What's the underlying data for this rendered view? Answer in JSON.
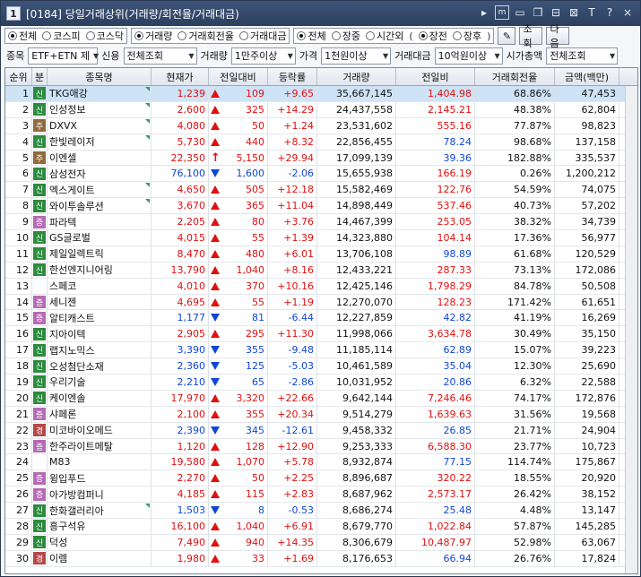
{
  "title": {
    "num": "1",
    "text": "[0184] 당일거래상위(거래량/회전율/거래대금)"
  },
  "toolbar": {
    "icons": [
      "arrow-right-icon",
      "menu-box-icon",
      "window-icon",
      "restore-icon",
      "link-icon",
      "lock-icon",
      "text-T-icon",
      "help-icon",
      "close-icon"
    ],
    "glyph_T": "T",
    "glyph_help": "?",
    "glyph_m": "m",
    "close": "×"
  },
  "market": {
    "options": [
      "전체",
      "코스피",
      "코스닥"
    ],
    "selected": 0
  },
  "sort": {
    "options": [
      "거래량",
      "거래회전율",
      "거래대금"
    ],
    "selected": 0
  },
  "session": {
    "options": [
      "전체",
      "장중",
      "시간외"
    ],
    "selected": 0,
    "sub_options": [
      "장전",
      "장후"
    ],
    "paren_open": "(",
    "paren_close": ")"
  },
  "buttons": {
    "search": "조회",
    "next": "다음"
  },
  "filters": {
    "item_label": "종목",
    "item_value": "ETF+ETN 제",
    "credit_label": "신용",
    "credit_value": "전체조회",
    "volume_label": "거래량",
    "volume_value": "1만주이상",
    "price_label": "가격",
    "price_value": "1천원이상",
    "amount_label": "거래대금",
    "amount_value": "10억원이상",
    "cap_label": "시가총액",
    "cap_value": "전체조회"
  },
  "columns": [
    "순위",
    "분",
    "종목명",
    "현재가",
    "전일대비",
    "등락률",
    "거래량",
    "전일비",
    "거래회전율",
    "금액(백만)"
  ],
  "rows": [
    {
      "rank": "1",
      "tag": "신",
      "tagc": "shin",
      "name": "TKG애강",
      "price": "1,239",
      "dir": "up",
      "chg": "109",
      "rate": "+9.65",
      "vol": "35,667,145",
      "prev": "1,404.98",
      "turn": "68.86%",
      "amt": "47,453",
      "flag": true
    },
    {
      "rank": "2",
      "tag": "신",
      "tagc": "shin",
      "name": "인성정보",
      "price": "2,600",
      "dir": "up",
      "chg": "325",
      "rate": "+14.29",
      "vol": "24,437,558",
      "prev": "2,145.21",
      "turn": "48.38%",
      "amt": "62,804",
      "flag": true
    },
    {
      "rank": "3",
      "tag": "주",
      "tagc": "ju",
      "name": "DXVX",
      "price": "4,080",
      "dir": "up",
      "chg": "50",
      "rate": "+1.24",
      "vol": "23,531,602",
      "prev": "555.16",
      "turn": "77.87%",
      "amt": "98,823",
      "flag": true
    },
    {
      "rank": "4",
      "tag": "신",
      "tagc": "shin",
      "name": "한빛레이저",
      "price": "5,730",
      "dir": "up",
      "chg": "440",
      "rate": "+8.32",
      "vol": "22,856,455",
      "prev": "78.24",
      "turn": "98.68%",
      "amt": "137,158",
      "flag": true
    },
    {
      "rank": "5",
      "tag": "주",
      "tagc": "ju",
      "name": "이엔셀",
      "price": "22,350",
      "dir": "limit",
      "chg": "5,150",
      "rate": "+29.94",
      "vol": "17,099,139",
      "prev": "39.36",
      "turn": "182.88%",
      "amt": "335,537",
      "flag": false
    },
    {
      "rank": "6",
      "tag": "신",
      "tagc": "shin",
      "name": "삼성전자",
      "price": "76,100",
      "dir": "dn",
      "chg": "1,600",
      "rate": "-2.06",
      "vol": "15,655,938",
      "prev": "166.19",
      "turn": "0.26%",
      "amt": "1,200,212",
      "flag": false
    },
    {
      "rank": "7",
      "tag": "신",
      "tagc": "shin",
      "name": "엑스게이트",
      "price": "4,650",
      "dir": "up",
      "chg": "505",
      "rate": "+12.18",
      "vol": "15,582,469",
      "prev": "122.76",
      "turn": "54.59%",
      "amt": "74,075",
      "flag": true
    },
    {
      "rank": "8",
      "tag": "신",
      "tagc": "shin",
      "name": "와이투솔루션",
      "price": "3,670",
      "dir": "up",
      "chg": "365",
      "rate": "+11.04",
      "vol": "14,898,449",
      "prev": "537.46",
      "turn": "40.73%",
      "amt": "57,202",
      "flag": true
    },
    {
      "rank": "9",
      "tag": "증",
      "tagc": "jeung",
      "name": "파라텍",
      "price": "2,205",
      "dir": "up",
      "chg": "80",
      "rate": "+3.76",
      "vol": "14,467,399",
      "prev": "253.05",
      "turn": "38.32%",
      "amt": "34,739",
      "flag": false
    },
    {
      "rank": "10",
      "tag": "신",
      "tagc": "shin",
      "name": "GS글로벌",
      "price": "4,015",
      "dir": "up",
      "chg": "55",
      "rate": "+1.39",
      "vol": "14,323,880",
      "prev": "104.14",
      "turn": "17.36%",
      "amt": "56,977",
      "flag": false
    },
    {
      "rank": "11",
      "tag": "신",
      "tagc": "shin",
      "name": "제일일렉트릭",
      "price": "8,470",
      "dir": "up",
      "chg": "480",
      "rate": "+6.01",
      "vol": "13,706,108",
      "prev": "98.89",
      "turn": "61.68%",
      "amt": "120,529",
      "flag": false
    },
    {
      "rank": "12",
      "tag": "신",
      "tagc": "shin",
      "name": "한선엔지니어링",
      "price": "13,790",
      "dir": "up",
      "chg": "1,040",
      "rate": "+8.16",
      "vol": "12,433,221",
      "prev": "287.33",
      "turn": "73.13%",
      "amt": "172,086",
      "flag": false
    },
    {
      "rank": "13",
      "tag": "",
      "tagc": "",
      "name": "스페코",
      "price": "4,010",
      "dir": "up",
      "chg": "370",
      "rate": "+10.16",
      "vol": "12,425,146",
      "prev": "1,798.29",
      "turn": "84.78%",
      "amt": "50,508",
      "flag": false
    },
    {
      "rank": "14",
      "tag": "증",
      "tagc": "jeung",
      "name": "세니젠",
      "price": "4,695",
      "dir": "up",
      "chg": "55",
      "rate": "+1.19",
      "vol": "12,270,070",
      "prev": "128.23",
      "turn": "171.42%",
      "amt": "61,651",
      "flag": false
    },
    {
      "rank": "15",
      "tag": "증",
      "tagc": "jeung",
      "name": "알티캐스트",
      "price": "1,177",
      "dir": "dn",
      "chg": "81",
      "rate": "-6.44",
      "vol": "12,227,859",
      "prev": "42.82",
      "turn": "41.19%",
      "amt": "16,269",
      "flag": false
    },
    {
      "rank": "16",
      "tag": "신",
      "tagc": "shin",
      "name": "지아이텍",
      "price": "2,905",
      "dir": "up",
      "chg": "295",
      "rate": "+11.30",
      "vol": "11,998,066",
      "prev": "3,634.78",
      "turn": "30.49%",
      "amt": "35,150",
      "flag": false
    },
    {
      "rank": "17",
      "tag": "신",
      "tagc": "shin",
      "name": "랩지노믹스",
      "price": "3,390",
      "dir": "dn",
      "chg": "355",
      "rate": "-9.48",
      "vol": "11,185,114",
      "prev": "62.89",
      "turn": "15.07%",
      "amt": "39,223",
      "flag": false
    },
    {
      "rank": "18",
      "tag": "신",
      "tagc": "shin",
      "name": "오성첨단소재",
      "price": "2,360",
      "dir": "dn",
      "chg": "125",
      "rate": "-5.03",
      "vol": "10,461,589",
      "prev": "35.04",
      "turn": "12.30%",
      "amt": "25,690",
      "flag": false
    },
    {
      "rank": "19",
      "tag": "신",
      "tagc": "shin",
      "name": "우리기술",
      "price": "2,210",
      "dir": "dn",
      "chg": "65",
      "rate": "-2.86",
      "vol": "10,031,952",
      "prev": "20.86",
      "turn": "6.32%",
      "amt": "22,588",
      "flag": false
    },
    {
      "rank": "20",
      "tag": "신",
      "tagc": "shin",
      "name": "케이엔솔",
      "price": "17,970",
      "dir": "up",
      "chg": "3,320",
      "rate": "+22.66",
      "vol": "9,642,144",
      "prev": "7,246.46",
      "turn": "74.17%",
      "amt": "172,876",
      "flag": false
    },
    {
      "rank": "21",
      "tag": "증",
      "tagc": "jeung",
      "name": "샤페론",
      "price": "2,100",
      "dir": "up",
      "chg": "355",
      "rate": "+20.34",
      "vol": "9,514,279",
      "prev": "1,639.63",
      "turn": "31.56%",
      "amt": "19,568",
      "flag": false
    },
    {
      "rank": "22",
      "tag": "경",
      "tagc": "gyeong",
      "name": "미코바이오메드",
      "price": "2,390",
      "dir": "dn",
      "chg": "345",
      "rate": "-12.61",
      "vol": "9,458,332",
      "prev": "26.85",
      "turn": "21.71%",
      "amt": "24,904",
      "flag": false
    },
    {
      "rank": "23",
      "tag": "증",
      "tagc": "jeung",
      "name": "한주라이트메탈",
      "price": "1,120",
      "dir": "up",
      "chg": "128",
      "rate": "+12.90",
      "vol": "9,253,333",
      "prev": "6,588.30",
      "turn": "23.77%",
      "amt": "10,723",
      "flag": false
    },
    {
      "rank": "24",
      "tag": "",
      "tagc": "",
      "name": "M83",
      "price": "19,580",
      "dir": "up",
      "chg": "1,070",
      "rate": "+5.78",
      "vol": "8,932,874",
      "prev": "77.15",
      "turn": "114.74%",
      "amt": "175,867",
      "flag": false
    },
    {
      "rank": "25",
      "tag": "증",
      "tagc": "jeung",
      "name": "윙입푸드",
      "price": "2,270",
      "dir": "up",
      "chg": "50",
      "rate": "+2.25",
      "vol": "8,896,687",
      "prev": "320.22",
      "turn": "18.55%",
      "amt": "20,920",
      "flag": false
    },
    {
      "rank": "26",
      "tag": "증",
      "tagc": "jeung",
      "name": "아가방컴퍼니",
      "price": "4,185",
      "dir": "up",
      "chg": "115",
      "rate": "+2.83",
      "vol": "8,687,962",
      "prev": "2,573.17",
      "turn": "26.42%",
      "amt": "38,152",
      "flag": false
    },
    {
      "rank": "27",
      "tag": "신",
      "tagc": "shin",
      "name": "한화갤러리아",
      "price": "1,503",
      "dir": "dn",
      "chg": "8",
      "rate": "-0.53",
      "vol": "8,686,274",
      "prev": "25.48",
      "turn": "4.48%",
      "amt": "13,147",
      "flag": true
    },
    {
      "rank": "28",
      "tag": "신",
      "tagc": "shin",
      "name": "흥구석유",
      "price": "16,100",
      "dir": "up",
      "chg": "1,040",
      "rate": "+6.91",
      "vol": "8,679,770",
      "prev": "1,022.84",
      "turn": "57.87%",
      "amt": "145,285",
      "flag": false
    },
    {
      "rank": "29",
      "tag": "신",
      "tagc": "shin",
      "name": "덕성",
      "price": "7,490",
      "dir": "up",
      "chg": "940",
      "rate": "+14.35",
      "vol": "8,306,679",
      "prev": "10,487.97",
      "turn": "52.98%",
      "amt": "63,067",
      "flag": false
    },
    {
      "rank": "30",
      "tag": "경",
      "tagc": "gyeong",
      "name": "이렘",
      "price": "1,980",
      "dir": "up",
      "chg": "33",
      "rate": "+1.69",
      "vol": "8,176,653",
      "prev": "66.94",
      "turn": "26.76%",
      "amt": "17,824",
      "flag": false
    }
  ],
  "colors": {
    "up": "#e01010",
    "down": "#1046d8",
    "title_bg": "#2c3f5e",
    "selected_row": "#cfe3f6"
  }
}
